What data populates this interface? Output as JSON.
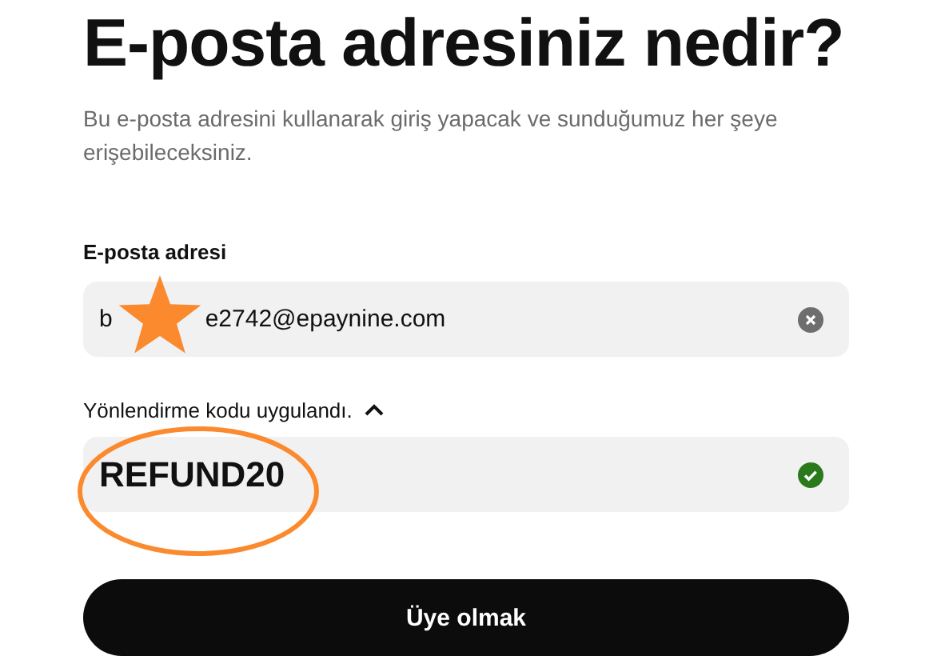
{
  "heading": "E-posta adresiniz nedir?",
  "subtitle": "Bu e-posta adresini kullanarak giriş yapacak ve sunduğumuz her şeye erişebileceksiniz.",
  "email_field": {
    "label": "E-posta adresi",
    "value_start": "b",
    "value_end": "e2742@epaynine.com"
  },
  "code_section": {
    "label": "Yönlendirme kodu uygulandı.",
    "expanded": true,
    "value": "REFUND20",
    "valid": true
  },
  "submit_button": {
    "label": "Üye olmak"
  },
  "star_mark": {
    "color": "#fb8a2e"
  },
  "circle_mark": {
    "color": "#fb8a2e"
  }
}
